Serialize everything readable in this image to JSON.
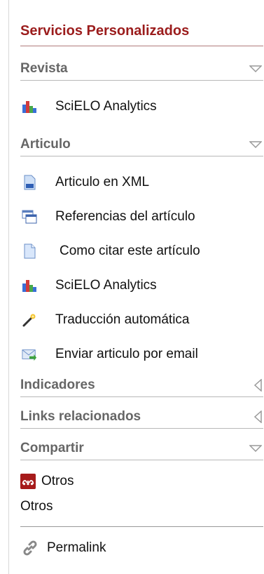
{
  "panel": {
    "title": "Servicios Personalizados",
    "colors": {
      "title": "#9b1c1c",
      "section": "#666666"
    }
  },
  "revista": {
    "heading": "Revista",
    "items": [
      {
        "label": "SciELO Analytics",
        "icon": "bar-chart-icon"
      }
    ]
  },
  "articulo": {
    "heading": "Articulo",
    "items": [
      {
        "label": "Articulo en XML",
        "icon": "xml-document-icon"
      },
      {
        "label": "Referencias del artículo",
        "icon": "windows-icon"
      },
      {
        "label": "Como citar este artículo",
        "icon": "document-icon"
      },
      {
        "label": "SciELO Analytics",
        "icon": "bar-chart-icon"
      },
      {
        "label": "Traducción automática",
        "icon": "magic-wand-icon"
      },
      {
        "label": "Enviar articulo por email",
        "icon": "email-icon"
      }
    ]
  },
  "indicadores": {
    "heading": "Indicadores"
  },
  "links": {
    "heading": "Links relacionados"
  },
  "compartir": {
    "heading": "Compartir",
    "items": [
      {
        "label": "Otros",
        "icon": "mendeley-icon"
      }
    ],
    "text": "Otros"
  },
  "permalink": {
    "label": "Permalink",
    "icon": "link-icon"
  }
}
